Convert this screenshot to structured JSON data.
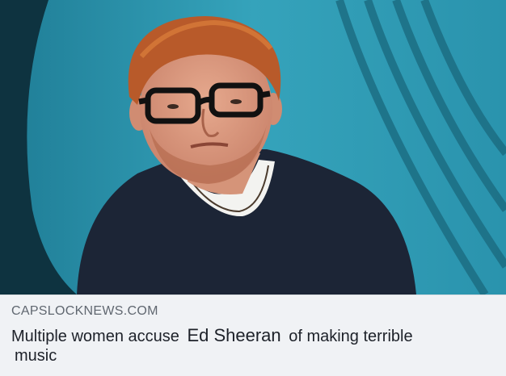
{
  "link_preview": {
    "domain": "CAPSLOCKNEWS.COM",
    "headline_prefix": "Multiple women accuse",
    "headline_name": "Ed Sheeran",
    "headline_suffix": "of making terrible",
    "headline_line2": "music"
  },
  "colors": {
    "caption_background": "#f0f2f5",
    "domain_text": "#606770",
    "headline_text": "#1d2129",
    "photo_backdrop": "#2a8ea6"
  }
}
